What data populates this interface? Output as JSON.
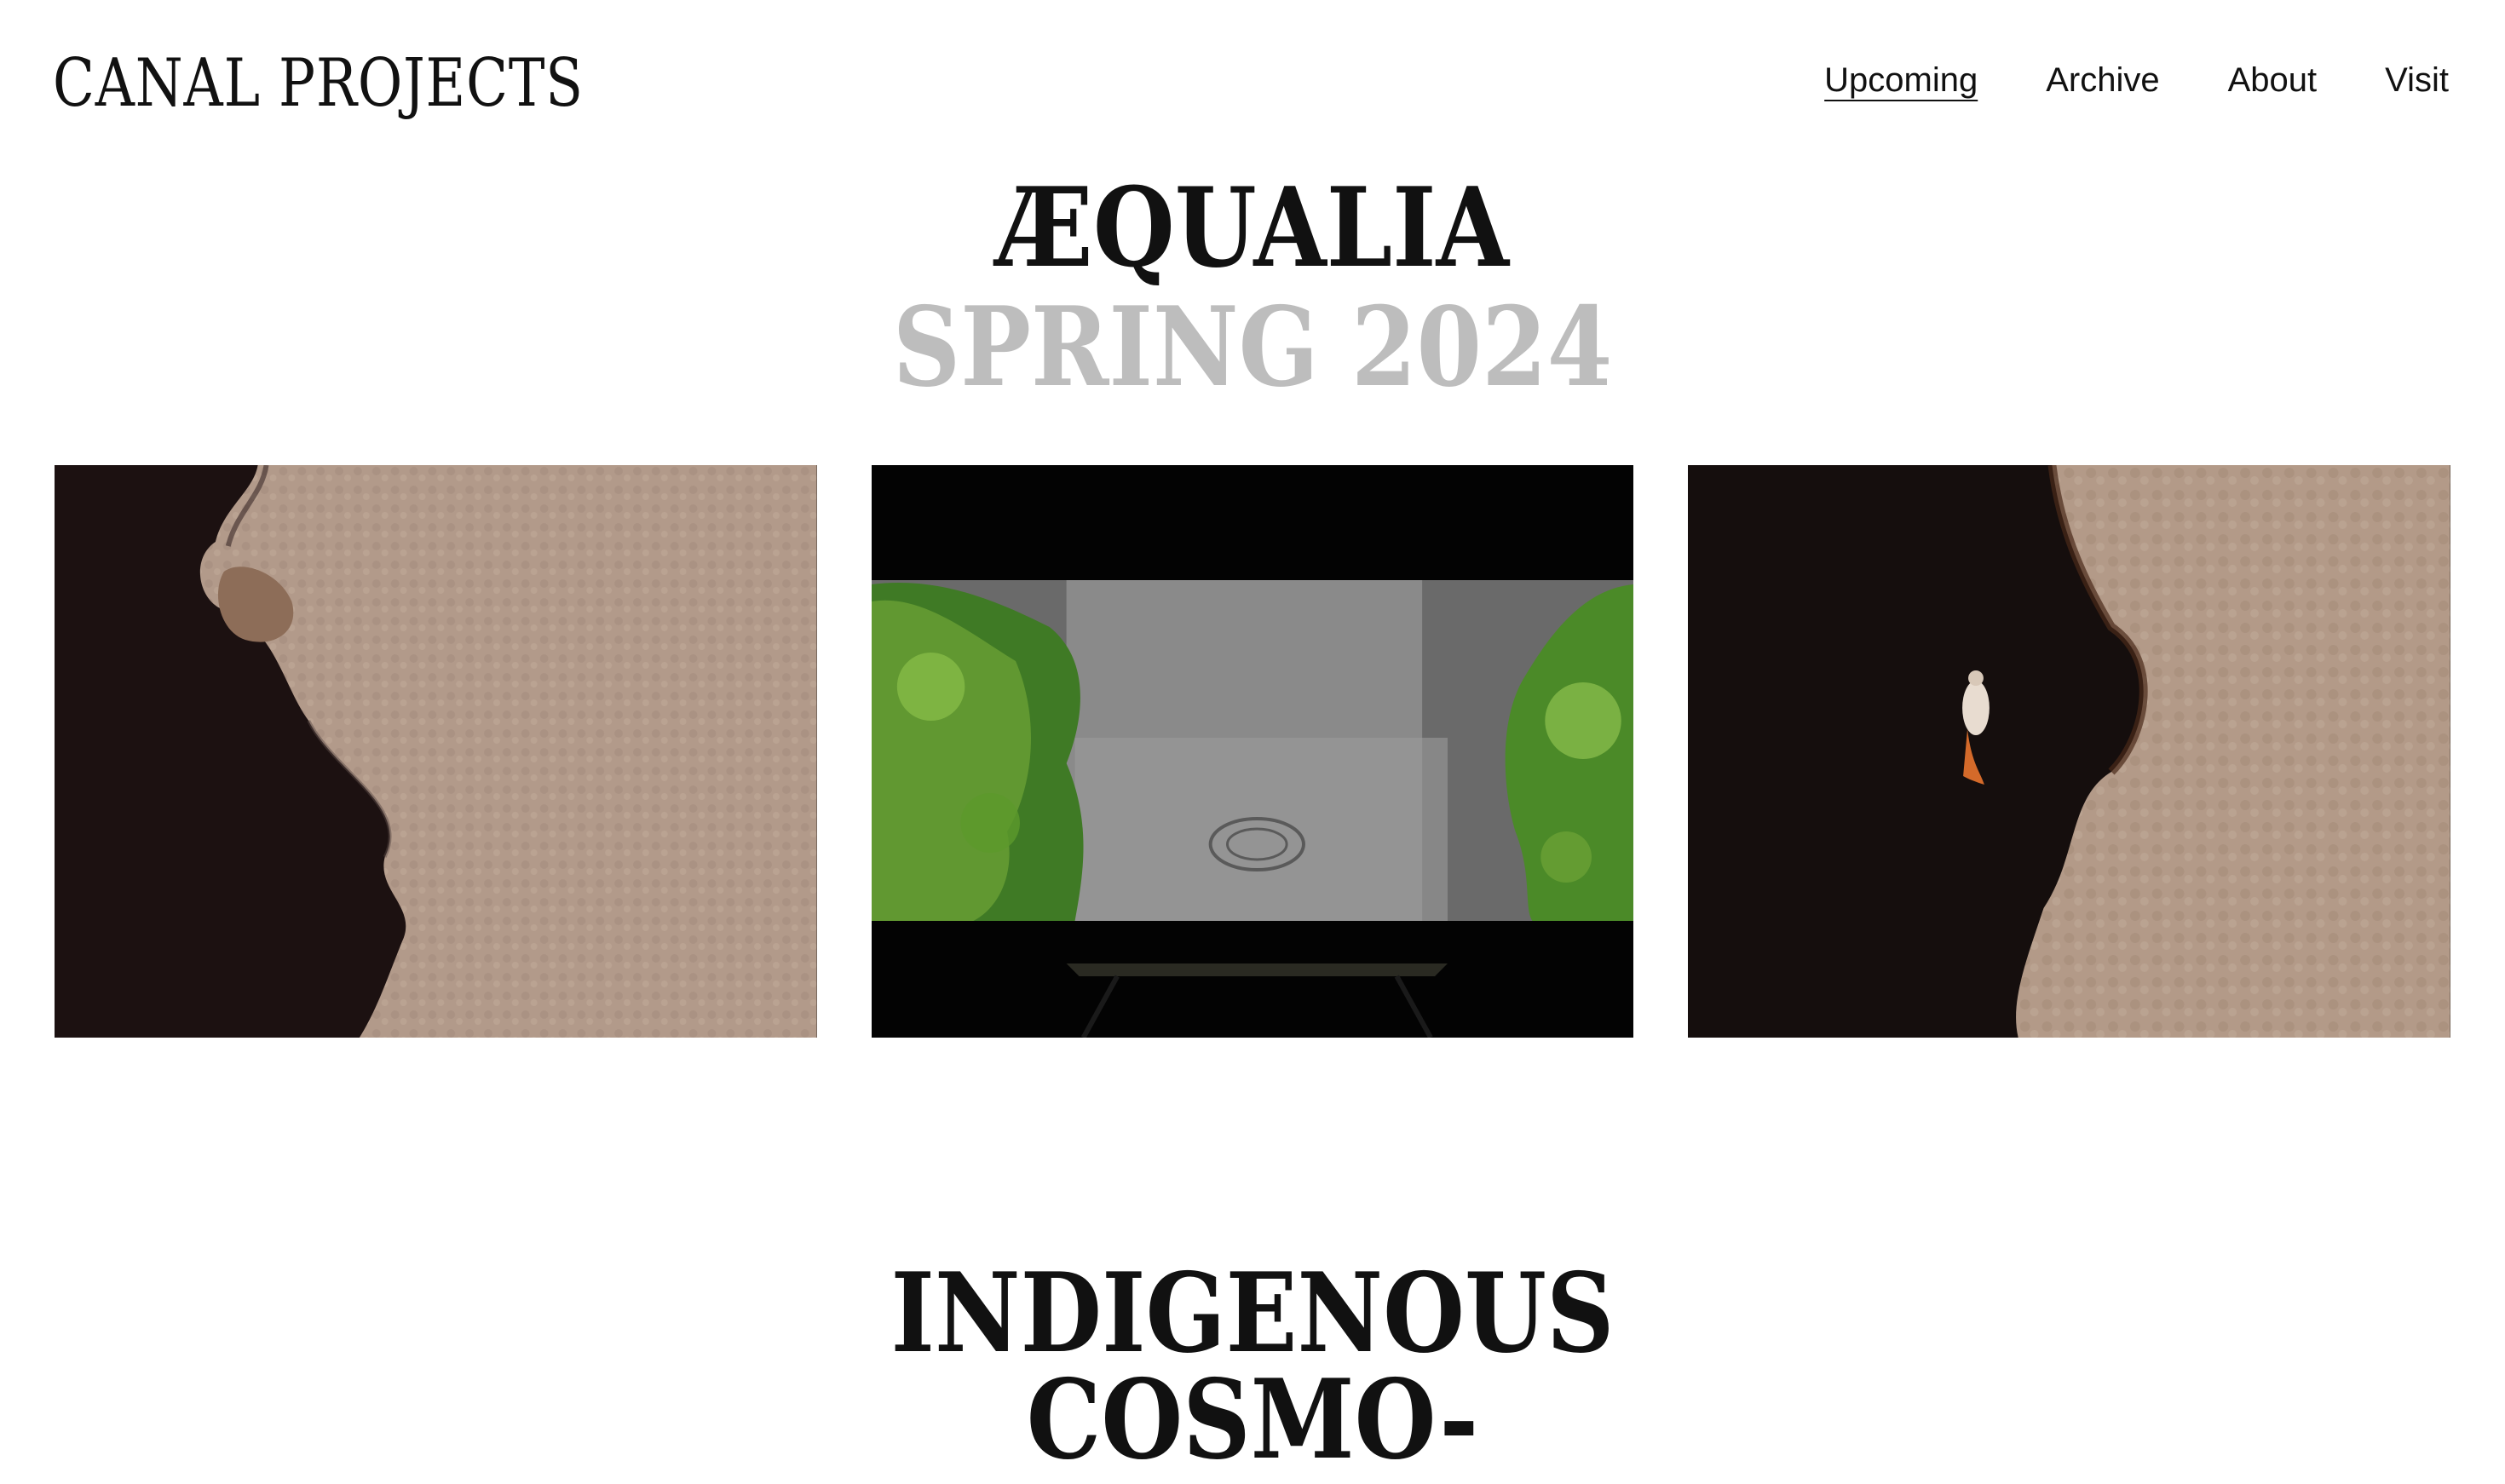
{
  "site": {
    "logo": "CANAL PROJECTS"
  },
  "nav": {
    "items": [
      {
        "label": "Upcoming",
        "active": true
      },
      {
        "label": "Archive",
        "active": false
      },
      {
        "label": "About",
        "active": false
      },
      {
        "label": "Visit",
        "active": false
      }
    ]
  },
  "exhibition": {
    "title": "ÆQUALIA",
    "season": "SPRING 2024",
    "images": [
      {
        "name": "aerial-river-confluence-left"
      },
      {
        "name": "installation-screen-jungle-river"
      },
      {
        "name": "aerial-river-swimmer"
      }
    ]
  },
  "next_exhibition": {
    "title_line1": "INDIGENOUS",
    "title_line2": "COSMO-"
  },
  "colors": {
    "text": "#111111",
    "season_gray": "#bdbdbd",
    "background": "#ffffff"
  }
}
